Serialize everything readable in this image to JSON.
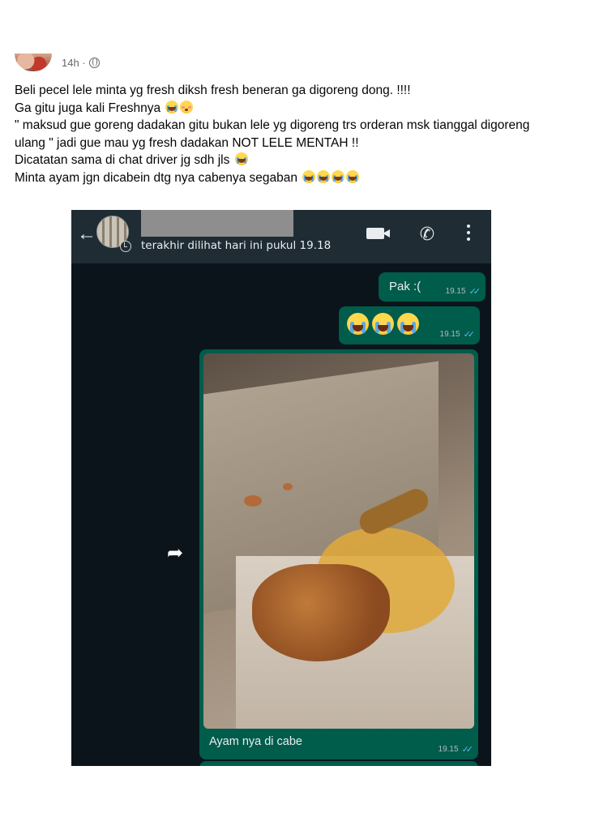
{
  "post": {
    "time": "14h ·",
    "lines": [
      "Beli pecel lele minta yg fresh diksh fresh beneran ga digoreng dong. !!!!",
      "Ga gitu juga kali Freshnya",
      "\" maksud gue goreng dadakan gitu bukan lele yg digoreng trs orderan msk tianggal digoreng",
      "ulang \" jadi gue mau yg fresh dadakan NOT LELE MENTAH !!",
      "Dicatatan sama di chat driver jg sdh jls",
      "Minta ayam jgn dicabein dtg nya cabenya segaban"
    ]
  },
  "chat": {
    "last_seen": "terakhir dilihat hari ini pukul 19.18",
    "messages": [
      {
        "text": "Pak :(",
        "time": "19.15"
      },
      {
        "text": "",
        "time": "19.15"
      },
      {
        "text": "Ayam nya di cabe",
        "time": "19.15"
      }
    ]
  },
  "icons": {
    "globe": "globe-icon",
    "back": "back-arrow-icon",
    "video": "video-call-icon",
    "call": "phone-call-icon",
    "menu": "more-vert-icon",
    "forward": "forward-icon",
    "read": "double-check-icon"
  },
  "colors": {
    "wa_header": "#1f2c34",
    "wa_background": "#0b141a",
    "outgoing_bubble": "#005c4b",
    "read_ticks": "#53bdeb"
  }
}
